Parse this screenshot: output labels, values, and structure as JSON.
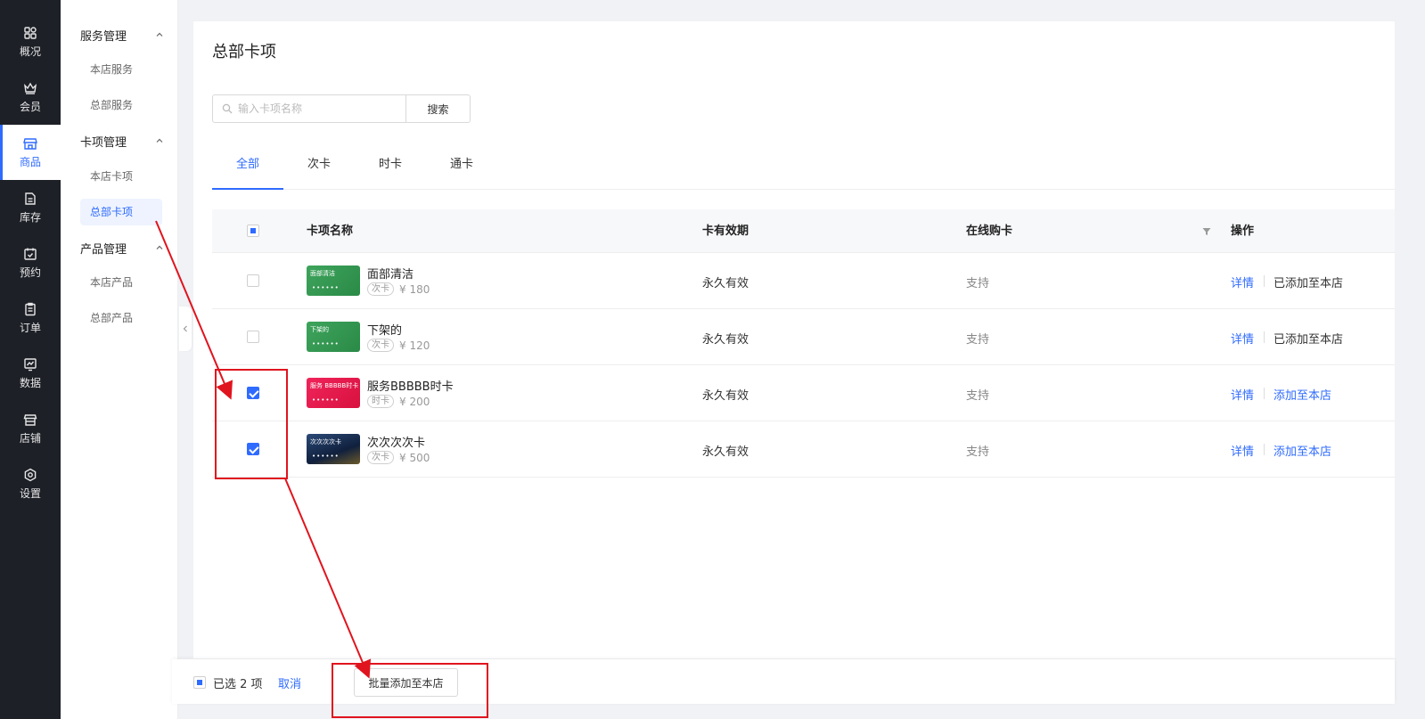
{
  "rail": {
    "items": [
      {
        "label": "概况",
        "icon": "dashboard-icon"
      },
      {
        "label": "会员",
        "icon": "crown-icon"
      },
      {
        "label": "商品",
        "icon": "store-icon"
      },
      {
        "label": "库存",
        "icon": "inventory-icon"
      },
      {
        "label": "预约",
        "icon": "calendar-check-icon"
      },
      {
        "label": "订单",
        "icon": "clipboard-icon"
      },
      {
        "label": "数据",
        "icon": "chart-icon"
      },
      {
        "label": "店铺",
        "icon": "shop-icon"
      },
      {
        "label": "设置",
        "icon": "settings-icon"
      }
    ],
    "active_index": 2
  },
  "subnav": {
    "groups": [
      {
        "label": "服务管理",
        "items": [
          "本店服务",
          "总部服务"
        ]
      },
      {
        "label": "卡项管理",
        "items": [
          "本店卡项",
          "总部卡项"
        ]
      },
      {
        "label": "产品管理",
        "items": [
          "本店产品",
          "总部产品"
        ]
      }
    ],
    "active_item": "总部卡项"
  },
  "page": {
    "title": "总部卡项",
    "search_placeholder": "输入卡项名称",
    "search_button": "搜索"
  },
  "tabs": [
    "全部",
    "次卡",
    "时卡",
    "通卡"
  ],
  "active_tab": "全部",
  "table": {
    "columns": [
      "卡项名称",
      "卡有效期",
      "在线购卡",
      "操作"
    ],
    "rows": [
      {
        "name": "面部清洁",
        "card_text": "面部清洁",
        "tag": "次卡",
        "price": "¥ 180",
        "validity": "永久有效",
        "online": "支持",
        "detail": "详情",
        "action": "已添加至本店",
        "action_added": true,
        "checked": false,
        "color": "#2f9e4f"
      },
      {
        "name": "下架的",
        "card_text": "下架的",
        "tag": "次卡",
        "price": "¥ 120",
        "validity": "永久有效",
        "online": "支持",
        "detail": "详情",
        "action": "已添加至本店",
        "action_added": true,
        "checked": false,
        "color": "#2f9e4f"
      },
      {
        "name": "服务BBBBB时卡",
        "card_text": "服务 BBBBB时卡",
        "tag": "时卡",
        "price": "¥ 200",
        "validity": "永久有效",
        "online": "支持",
        "detail": "详情",
        "action": "添加至本店",
        "action_added": false,
        "checked": true,
        "color": "#e8164f"
      },
      {
        "name": "次次次次卡",
        "card_text": "次次次次卡",
        "tag": "次卡",
        "price": "¥ 500",
        "validity": "永久有效",
        "online": "支持",
        "detail": "详情",
        "action": "添加至本店",
        "action_added": false,
        "checked": true,
        "color": "#1c2f52"
      }
    ]
  },
  "bottom": {
    "selected_text": "已选 2 项",
    "cancel": "取消",
    "batch_button": "批量添加至本店"
  },
  "colors": {
    "accent": "#2f6bff",
    "annotation": "#e0141e",
    "rail_bg": "#1d2027"
  }
}
